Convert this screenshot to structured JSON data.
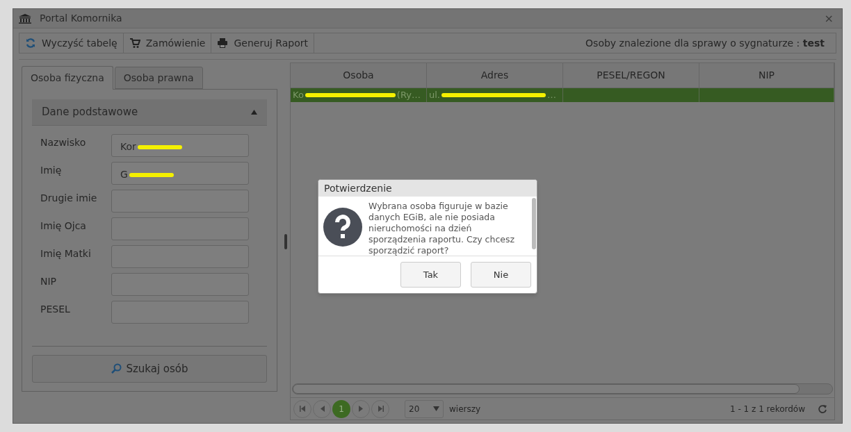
{
  "window": {
    "title": "Portal Komornika",
    "close": "×"
  },
  "toolbar": {
    "buttons": [
      {
        "label": "Wyczyść tabelę"
      },
      {
        "label": "Zamówienie"
      },
      {
        "label": "Generuj Raport"
      }
    ],
    "info": "Osoby znalezione dla sprawy o sygnaturze : **test**"
  },
  "tabs": [
    {
      "label": "Osoba fizyczna",
      "selected": true
    },
    {
      "label": "Osoba prawna",
      "selected": false
    }
  ],
  "section": {
    "title": "Dane podstawowe",
    "expanded": true
  },
  "fields": [
    {
      "label": "Nazwisko",
      "value": "Kor",
      "redacted": true
    },
    {
      "label": "Imię",
      "value": "G",
      "redacted": true
    },
    {
      "label": "Drugie imie",
      "redacted": false
    },
    {
      "label": "Imię Ojca",
      "redacted": false
    },
    {
      "label": "Imię Matki",
      "redacted": false
    },
    {
      "label": "NIP",
      "redacted": false
    },
    {
      "label": "PESEL",
      "redacted": false
    }
  ],
  "search_button": "Szukaj osób",
  "table": {
    "columns": [
      "Osoba",
      "Adres",
      "PESEL/REGON",
      "NIP"
    ],
    "rows": [
      {
        "selected": true,
        "cells": [
          {
            "before": "Ko",
            "after": "(Ry…"
          },
          {
            "before": "ul.",
            "after": "…"
          }
        ]
      }
    ]
  },
  "pager": {
    "pages": [
      {
        "label": "1",
        "selected": true
      }
    ],
    "page_size": "20",
    "page_size_label": "wierszy",
    "summary": "1 - 1 z 1 rekordów"
  },
  "dialog": {
    "title": "Potwierdzenie",
    "message": "Wybrana osoba figuruje w bazie danych EGiB, ale nie posiada nieruchomości na dzień sporządzenia raportu. Czy chcesz sporządzić raport?",
    "buttons": [
      "Tak",
      "Nie"
    ]
  }
}
